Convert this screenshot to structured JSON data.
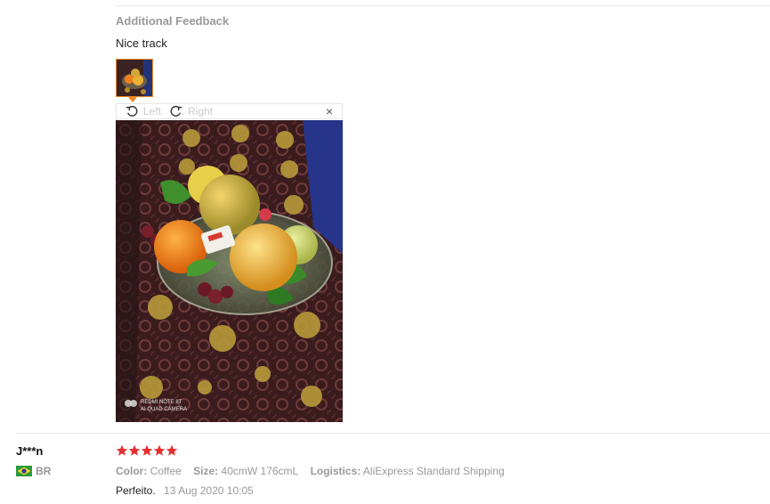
{
  "feedback": {
    "heading": "Additional Feedback",
    "text": "Nice track"
  },
  "viewer": {
    "rotate_left_label": "Left",
    "rotate_right_label": "Right",
    "close_label": "×",
    "watermark_line1": "REDMI NOTE 8T",
    "watermark_line2": "AI QUAD CAMERA"
  },
  "review": {
    "user": "J***n",
    "country": "BR",
    "rating": 5,
    "color_label": "Color:",
    "color_value": "Coffee",
    "size_label": "Size:",
    "size_value": "40cmW 176cmL",
    "logistics_label": "Logistics:",
    "logistics_value": "AliExpress Standard Shipping",
    "text": "Perfeito.",
    "date": "13 Aug 2020 10:05"
  },
  "colors": {
    "star": "#e62e2e",
    "thumb_border": "#f08a24"
  }
}
